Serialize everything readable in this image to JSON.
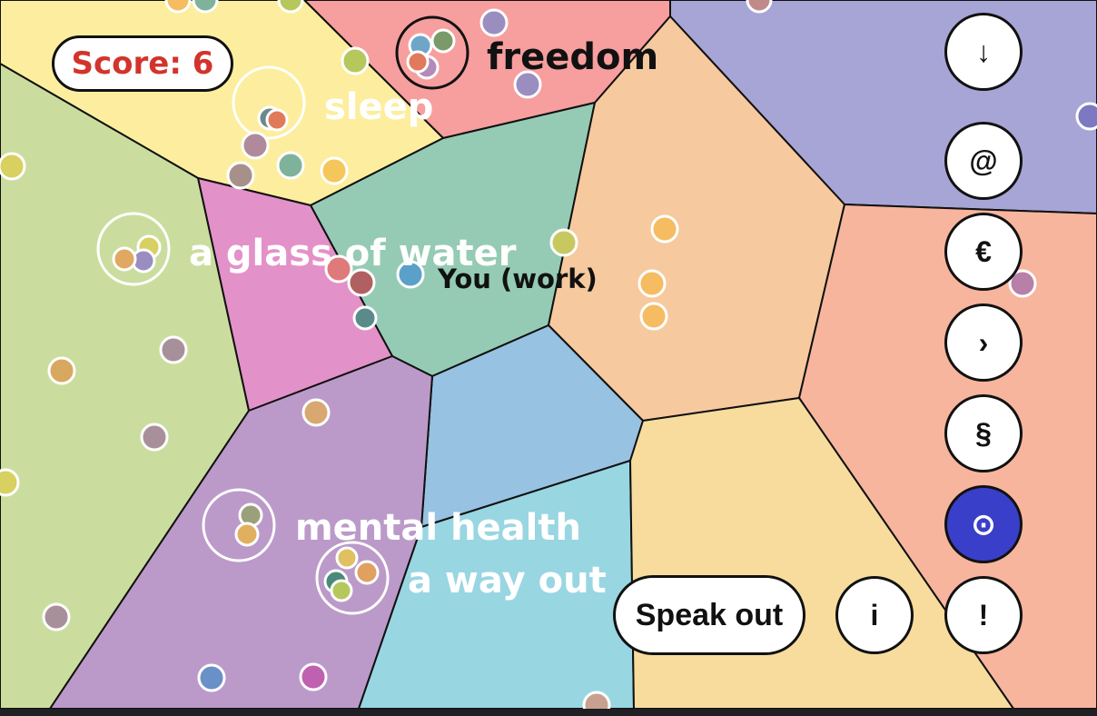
{
  "score": {
    "text": "Score: 6"
  },
  "labels": {
    "freedom": "freedom",
    "sleep": "sleep",
    "water": "a glass of water",
    "work": "You (work)",
    "mental": "mental health",
    "wayout": "a way out"
  },
  "buttons": {
    "down": {
      "glyph": "↓"
    },
    "at": {
      "glyph": "@"
    },
    "euro": {
      "glyph": "€"
    },
    "next": {
      "glyph": "›"
    },
    "section": {
      "glyph": "§"
    },
    "target": {
      "glyph": "⊙"
    },
    "info": {
      "glyph": "i"
    },
    "alert": {
      "glyph": "!"
    },
    "speak": {
      "label": "Speak out"
    }
  },
  "colors": {
    "score_text": "#d2342c",
    "active_button": "#3a3fc9",
    "region_sleep": "#fcee9e",
    "region_freedom": "#f79e9e",
    "region_work": "#95cbb4",
    "region_water": "#e391c9",
    "region_green": "#cbdd9e",
    "region_peach": "#f7c99e",
    "region_lavender": "#a7a5d6",
    "region_salmon": "#f7b59e",
    "region_blue": "#97c2e2",
    "region_purple": "#bb9ac9",
    "region_cyan": "#98d6e2",
    "region_yellow": "#f7dc9e"
  }
}
